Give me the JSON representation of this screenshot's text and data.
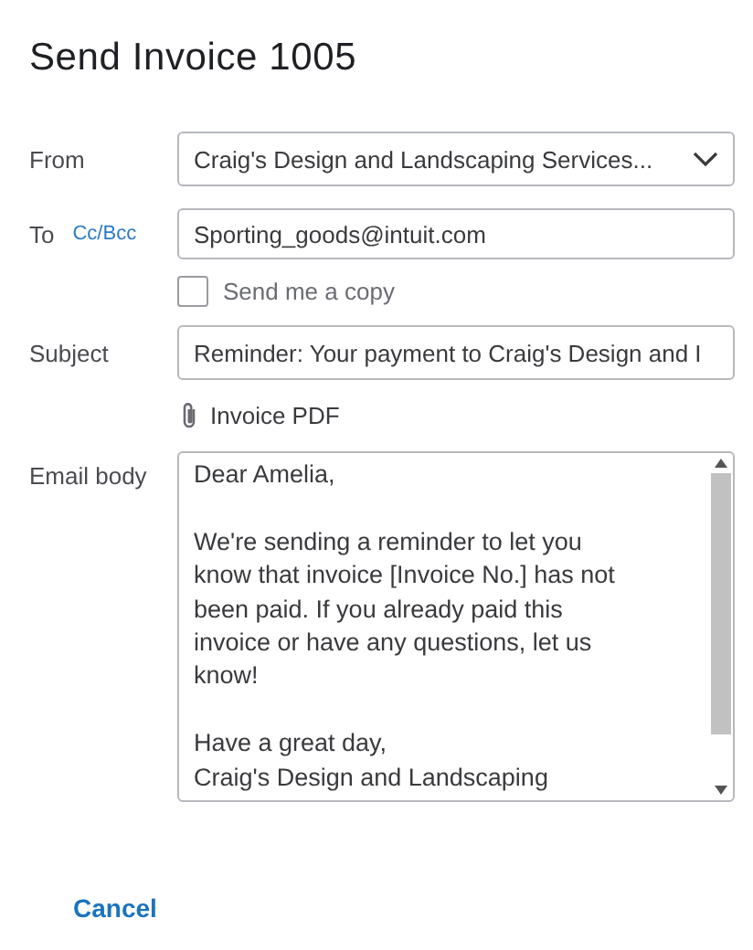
{
  "title": "Send Invoice 1005",
  "from": {
    "label": "From",
    "value": "Craig's Design and Landscaping Services..."
  },
  "to": {
    "label": "To",
    "cc_link": "Cc/Bcc",
    "value": "Sporting_goods@intuit.com"
  },
  "send_copy": {
    "label": "Send me a copy",
    "checked": false
  },
  "subject": {
    "label": "Subject",
    "value": "Reminder: Your payment to Craig's Design and I"
  },
  "attachment": {
    "label": "Invoice PDF"
  },
  "email_body": {
    "label": "Email body",
    "paragraphs": [
      [
        "Dear Amelia,"
      ],
      [
        "We're sending a reminder to let you",
        "know that invoice [Invoice No.] has not",
        "been paid. If you already paid this",
        "invoice or have any questions, let us",
        "know!"
      ],
      [
        "Have a great day,",
        "Craig's Design and Landscaping"
      ]
    ]
  },
  "cancel": "Cancel"
}
